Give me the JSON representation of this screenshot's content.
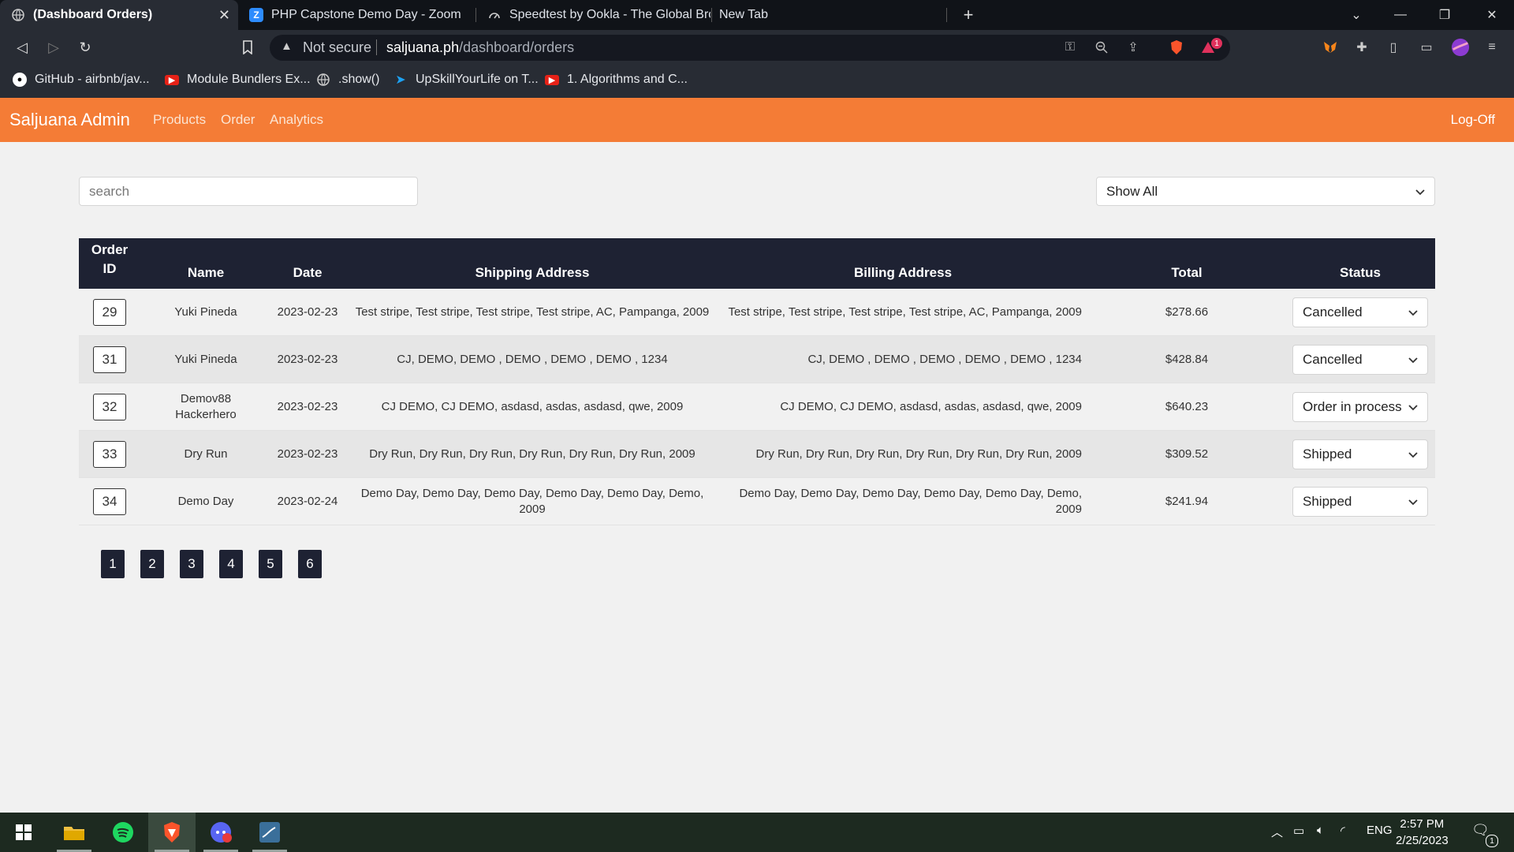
{
  "browser": {
    "tabs": [
      {
        "label": "(Dashboard Orders)",
        "active": true,
        "icon": "globe-icon"
      },
      {
        "label": "PHP Capstone Demo Day - Zoom",
        "active": false,
        "icon": "zoom-icon"
      },
      {
        "label": "Speedtest by Ookla - The Global Broad",
        "active": false,
        "icon": "speedtest-icon"
      },
      {
        "label": "New Tab",
        "active": false,
        "icon": ""
      }
    ],
    "address": {
      "security": "Not secure",
      "host": "saljuana.ph",
      "path": "/dashboard/orders"
    },
    "bookmarks": [
      {
        "label": "GitHub - airbnb/jav...",
        "icon": "github-icon"
      },
      {
        "label": "Module Bundlers Ex...",
        "icon": "youtube-icon"
      },
      {
        "label": ".show()",
        "icon": "globe-icon"
      },
      {
        "label": "UpSkillYourLife on T...",
        "icon": "twitter-icon"
      },
      {
        "label": "1. Algorithms and C...",
        "icon": "youtube-icon"
      }
    ],
    "notification_count": "1"
  },
  "app": {
    "brand": "Saljuana Admin",
    "nav": [
      "Products",
      "Order",
      "Analytics"
    ],
    "logoff": "Log-Off",
    "accent_color": "#f47c36",
    "header_color": "#1e2233"
  },
  "controls": {
    "search_placeholder": "search",
    "filter_value": "Show All"
  },
  "table": {
    "headers": {
      "order_id_line1": "Order",
      "order_id_line2": "ID",
      "name": "Name",
      "date": "Date",
      "shipping": "Shipping Address",
      "billing": "Billing Address",
      "total": "Total",
      "status": "Status"
    },
    "rows": [
      {
        "id": "29",
        "name": "Yuki Pineda",
        "date": "2023-02-23",
        "shipping": "Test stripe, Test stripe, Test stripe, Test stripe, AC, Pampanga, 2009",
        "billing": "Test stripe, Test stripe, Test stripe, Test stripe, AC, Pampanga, 2009",
        "total": "$278.66",
        "status": "Cancelled"
      },
      {
        "id": "31",
        "name": "Yuki Pineda",
        "date": "2023-02-23",
        "shipping": "CJ, DEMO, DEMO , DEMO , DEMO , DEMO , 1234",
        "billing": "CJ, DEMO , DEMO , DEMO , DEMO , DEMO , 1234",
        "total": "$428.84",
        "status": "Cancelled"
      },
      {
        "id": "32",
        "name": "Demov88 Hackerhero",
        "date": "2023-02-23",
        "shipping": "CJ DEMO, CJ DEMO, asdasd, asdas, asdasd, qwe, 2009",
        "billing": "CJ DEMO, CJ DEMO, asdasd, asdas, asdasd, qwe, 2009",
        "total": "$640.23",
        "status": "Order in process"
      },
      {
        "id": "33",
        "name": "Dry Run",
        "date": "2023-02-23",
        "shipping": "Dry Run, Dry Run, Dry Run, Dry Run, Dry Run, Dry Run, 2009",
        "billing": "Dry Run, Dry Run, Dry Run, Dry Run, Dry Run, Dry Run, 2009",
        "total": "$309.52",
        "status": "Shipped"
      },
      {
        "id": "34",
        "name": "Demo Day",
        "date": "2023-02-24",
        "shipping": "Demo Day, Demo Day, Demo Day, Demo Day, Demo Day, Demo, 2009",
        "billing": "Demo Day, Demo Day, Demo Day, Demo Day, Demo Day, Demo, 2009",
        "total": "$241.94",
        "status": "Shipped"
      }
    ]
  },
  "pagination": [
    "1",
    "2",
    "3",
    "4",
    "5",
    "6"
  ],
  "taskbar": {
    "apps": [
      "windows-start-icon",
      "file-explorer-icon",
      "spotify-icon",
      "brave-icon",
      "discord-icon",
      "mysql-workbench-icon"
    ],
    "language": "ENG",
    "time": "2:57 PM",
    "date": "2/25/2023",
    "notifications": "1"
  }
}
